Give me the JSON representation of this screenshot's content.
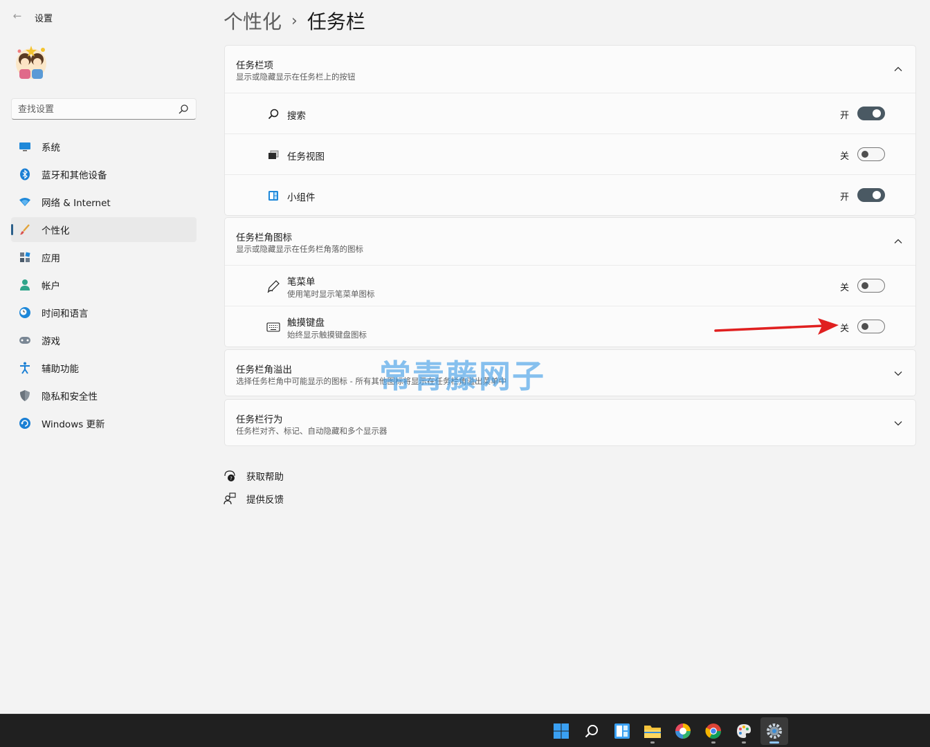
{
  "app": {
    "title": "设置",
    "back_symbol": "←"
  },
  "search": {
    "placeholder": "查找设置",
    "value": ""
  },
  "nav": {
    "items": [
      {
        "label": "系统",
        "icon": "monitor-icon"
      },
      {
        "label": "蓝牙和其他设备",
        "icon": "bluetooth-icon"
      },
      {
        "label": "网络 & Internet",
        "icon": "wifi-icon"
      },
      {
        "label": "个性化",
        "icon": "brush-icon",
        "active": true
      },
      {
        "label": "应用",
        "icon": "apps-icon"
      },
      {
        "label": "帐户",
        "icon": "person-icon"
      },
      {
        "label": "时间和语言",
        "icon": "clock-globe-icon"
      },
      {
        "label": "游戏",
        "icon": "gamepad-icon"
      },
      {
        "label": "辅助功能",
        "icon": "accessibility-icon"
      },
      {
        "label": "隐私和安全性",
        "icon": "shield-icon"
      },
      {
        "label": "Windows 更新",
        "icon": "update-icon"
      }
    ]
  },
  "breadcrumb": {
    "parent": "个性化",
    "separator": "›",
    "current": "任务栏"
  },
  "taskbar_items": {
    "title": "任务栏项",
    "subtitle": "显示或隐藏显示在任务栏上的按钮",
    "rows": [
      {
        "label": "搜索",
        "state": "开",
        "on": true,
        "icon": "search-icon"
      },
      {
        "label": "任务视图",
        "state": "关",
        "on": false,
        "icon": "task-view-icon"
      },
      {
        "label": "小组件",
        "state": "开",
        "on": true,
        "icon": "widgets-icon"
      }
    ]
  },
  "corner_icons": {
    "title": "任务栏角图标",
    "subtitle": "显示或隐藏显示在任务栏角落的图标",
    "rows": [
      {
        "label": "笔菜单",
        "sub": "使用笔时显示笔菜单图标",
        "state": "关",
        "on": false,
        "icon": "pen-icon"
      },
      {
        "label": "触摸键盘",
        "sub": "始终显示触摸键盘图标",
        "state": "关",
        "on": false,
        "icon": "keyboard-icon"
      }
    ]
  },
  "corner_overflow": {
    "title": "任务栏角溢出",
    "subtitle": "选择任务栏角中可能显示的图标 - 所有其他图标将显示在任务栏角溢出菜单中"
  },
  "behaviors": {
    "title": "任务栏行为",
    "subtitle": "任务栏对齐、标记、自动隐藏和多个显示器"
  },
  "footer": {
    "help": "获取帮助",
    "feedback": "提供反馈"
  },
  "watermark": "常青藤网子",
  "colors": {
    "accent": "#2b5f8a",
    "toggle_on": "#4a5963",
    "annotation_arrow": "#e02020",
    "watermark": "#46a0e6"
  },
  "system_taskbar": {
    "icons": [
      "start-icon",
      "search-icon",
      "widgets-icon",
      "file-explorer-icon",
      "colorful-app-icon",
      "chrome-icon",
      "paint-icon",
      "settings-gear-icon"
    ]
  }
}
